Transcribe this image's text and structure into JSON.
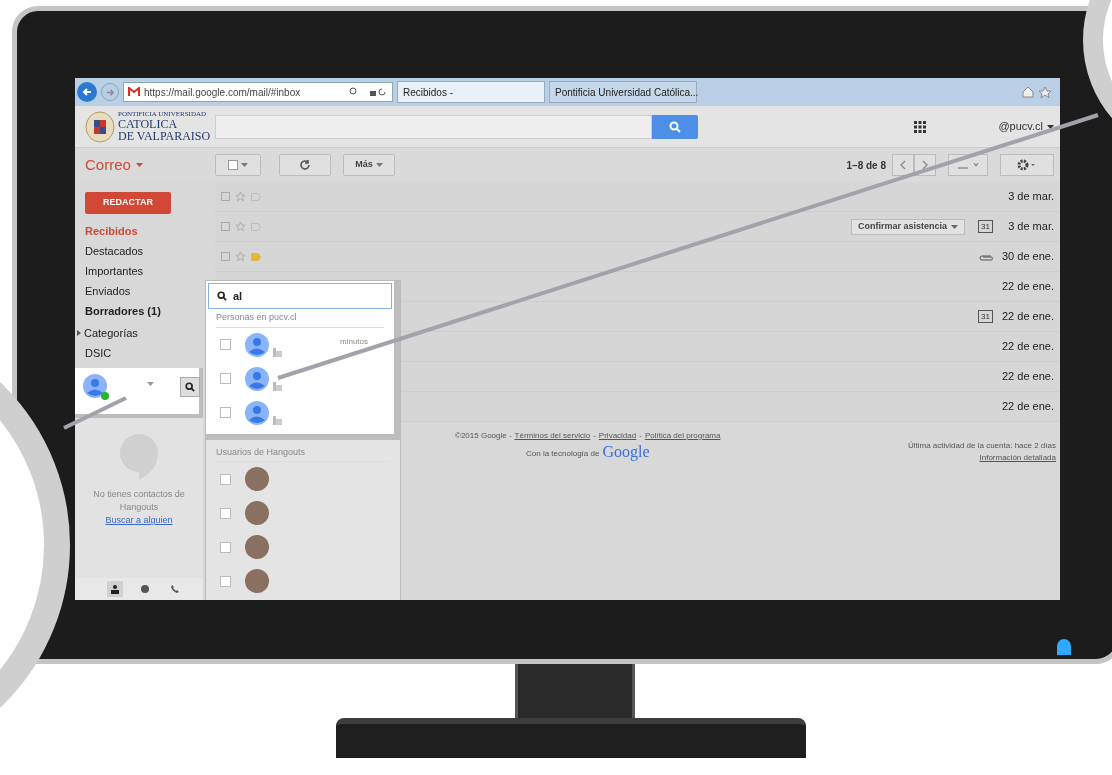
{
  "browser": {
    "address": "https://mail.google.com/mail/#inbox",
    "tabs": [
      {
        "label": "Recibidos -",
        "selected": true
      },
      {
        "label": "Pontificia Universidad Católica...",
        "selected": false
      }
    ]
  },
  "logo": {
    "small": "PONTIFICIA UNIVERSIDAD",
    "line1": "CATOLICA",
    "line2": "DE VALPARAISO"
  },
  "header": {
    "account": "@pucv.cl"
  },
  "toolbar": {
    "app": "Correo",
    "more": "Más",
    "pagination": "1–8 de 8"
  },
  "sidebar": {
    "compose": "REDACTAR",
    "items": [
      {
        "label": "Recibidos",
        "selected": true,
        "bold": true
      },
      {
        "label": "Destacados",
        "selected": false,
        "bold": false
      },
      {
        "label": "Importantes",
        "selected": false,
        "bold": false
      },
      {
        "label": "Enviados",
        "selected": false,
        "bold": false
      },
      {
        "label": "Borradores (1)",
        "selected": false,
        "bold": true
      },
      {
        "label": "Categorías",
        "selected": false,
        "bold": false,
        "kind": "group"
      },
      {
        "label": "DSIC",
        "selected": false,
        "bold": false
      }
    ]
  },
  "messages": [
    {
      "date": "3 de mar.",
      "important": false
    },
    {
      "date": "3 de mar.",
      "important": false,
      "action": "Confirmar asistencia",
      "kind": "calendar",
      "calendar_day": "31"
    },
    {
      "date": "30 de ene.",
      "important": true,
      "kind": "attachment"
    },
    {
      "date": "22 de ene."
    },
    {
      "date": "22 de ene.",
      "kind": "calendar",
      "calendar_day": "31"
    },
    {
      "date": "22 de ene."
    },
    {
      "date": "22 de ene."
    },
    {
      "date": "22 de ene."
    }
  ],
  "footer": {
    "copyright": "©2015 Google -",
    "links": [
      "Términos del servicio",
      "Privacidad",
      "Política del programa"
    ],
    "separators": [
      "-",
      "-"
    ],
    "powered": "Con la tecnología de",
    "brand": "Google",
    "activity": "Última actividad de la cuenta: hace 2 días",
    "details": "Información detallada"
  },
  "hangouts": {
    "empty": "No tienes contactos de Hangouts",
    "find": "Buscar a alguien",
    "tabs": [
      {
        "kind": "people",
        "selected": true
      },
      {
        "kind": "chat",
        "selected": false
      },
      {
        "kind": "phone",
        "selected": false
      }
    ]
  },
  "popup": {
    "query": "al",
    "sections": [
      {
        "title": "Personas en pucv.cl",
        "contacts": [
          {
            "checked": false,
            "note": "minutos"
          },
          {
            "checked": false
          },
          {
            "checked": false
          }
        ]
      },
      {
        "title": "Usuarios de Hangouts",
        "contacts": [
          {
            "checked": false
          },
          {
            "checked": false
          },
          {
            "checked": false
          },
          {
            "checked": false
          }
        ]
      }
    ]
  }
}
